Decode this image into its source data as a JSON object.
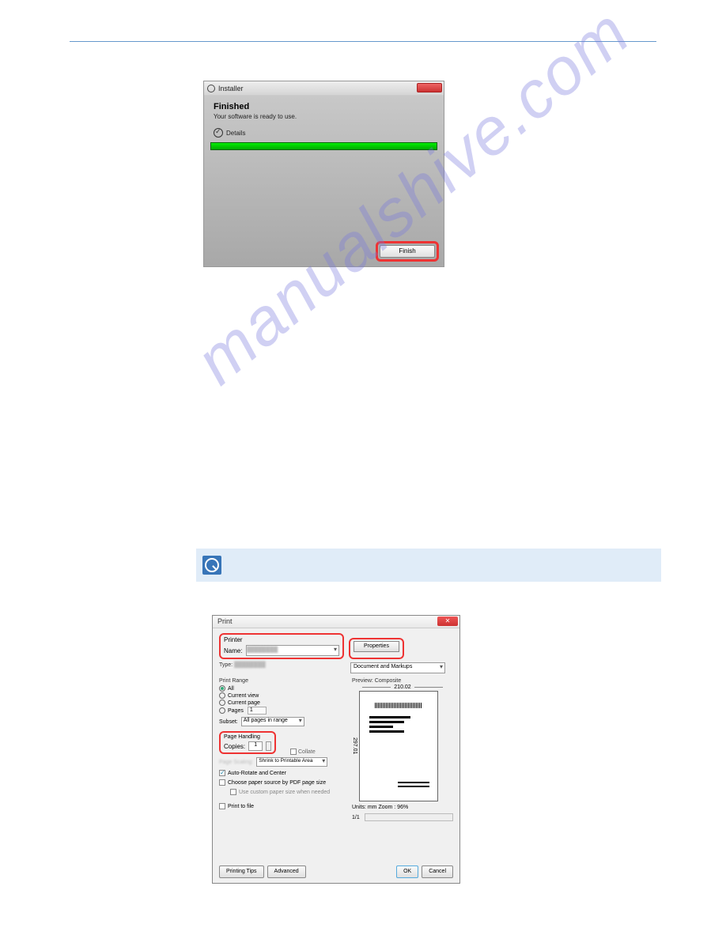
{
  "installer": {
    "title": "Installer",
    "heading": "Finished",
    "subtext": "Your software is ready to use.",
    "details": "Details",
    "finish": "Finish"
  },
  "print": {
    "title": "Print",
    "printer_label": "Printer",
    "name_label": "Name:",
    "properties": "Properties",
    "type_label": "Type:",
    "doc_markups": "Document and Markups",
    "range": {
      "title": "Print Range",
      "all": "All",
      "current_view": "Current view",
      "current_page": "Current page",
      "pages": "Pages",
      "pages_value": "1",
      "subset_label": "Subset:",
      "subset_value": "All pages in range"
    },
    "page_handling": {
      "title": "Page Handling",
      "copies_label": "Copies:",
      "copies_value": "1",
      "collate": "Collate",
      "scaling_value": "Shrink to Printable Area",
      "auto_rotate": "Auto-Rotate and Center",
      "choose_paper": "Choose paper source by PDF page size",
      "custom_paper": "Use custom paper size when needed"
    },
    "print_to_file": "Print to file",
    "preview": {
      "title": "Preview: Composite",
      "width": "210.02",
      "height": "297.01",
      "units": "Units: mm Zoom : 96%",
      "page": "1/1"
    },
    "buttons": {
      "tips": "Printing Tips",
      "advanced": "Advanced",
      "ok": "OK",
      "cancel": "Cancel"
    }
  },
  "watermark": "manualshive.com"
}
